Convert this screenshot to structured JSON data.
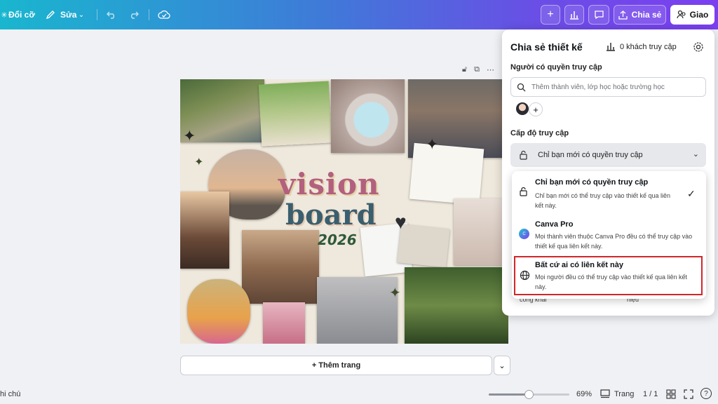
{
  "topbar": {
    "resize_label": "Đổi cỡ",
    "edit_label": "Sửa",
    "share_label": "Chia sẻ",
    "present_label": "Giao"
  },
  "canvas_toolbar": {
    "icons": [
      "lock-icon",
      "copy-icon",
      "more-icon"
    ]
  },
  "board": {
    "title_line1": "vision",
    "title_line2": "board",
    "year": "2026"
  },
  "share_panel": {
    "title": "Chia sẻ thiết kế",
    "visitors": "0 khách truy cập",
    "access_people_label": "Người có quyền truy cập",
    "search_placeholder": "Thêm thành viên, lớp học hoặc trường học",
    "access_level_label": "Cấp độ truy cập",
    "current_access": "Chỉ bạn mới có quyền truy cập",
    "under_labels": [
      "công khai",
      "hiệu"
    ]
  },
  "access_options": [
    {
      "title": "Chỉ bạn mới có quyền truy cập",
      "desc": "Chỉ bạn mới có thể truy cập vào thiết kế qua liên kết này.",
      "icon": "lock-icon",
      "selected": true
    },
    {
      "title": "Canva Pro",
      "desc": "Mọi thành viên thuộc Canva Pro đều có thể truy cập vào thiết kế qua liên kết này.",
      "icon": "canva-icon",
      "selected": false
    },
    {
      "title": "Bất cứ ai có liên kết này",
      "desc": "Mọi người đều có thể truy cập vào thiết kế qua liên kết này.",
      "icon": "globe-icon",
      "selected": false,
      "highlighted": true
    }
  ],
  "add_page_label": "+ Thêm trang",
  "bottom": {
    "notes_label": "hi chú",
    "zoom": "69%",
    "zoom_level": 0.69,
    "pages_label": "Trang",
    "page_count": "1 / 1"
  },
  "colors": {
    "highlight_border": "#d0262a",
    "accent": "#7b3ff0"
  }
}
